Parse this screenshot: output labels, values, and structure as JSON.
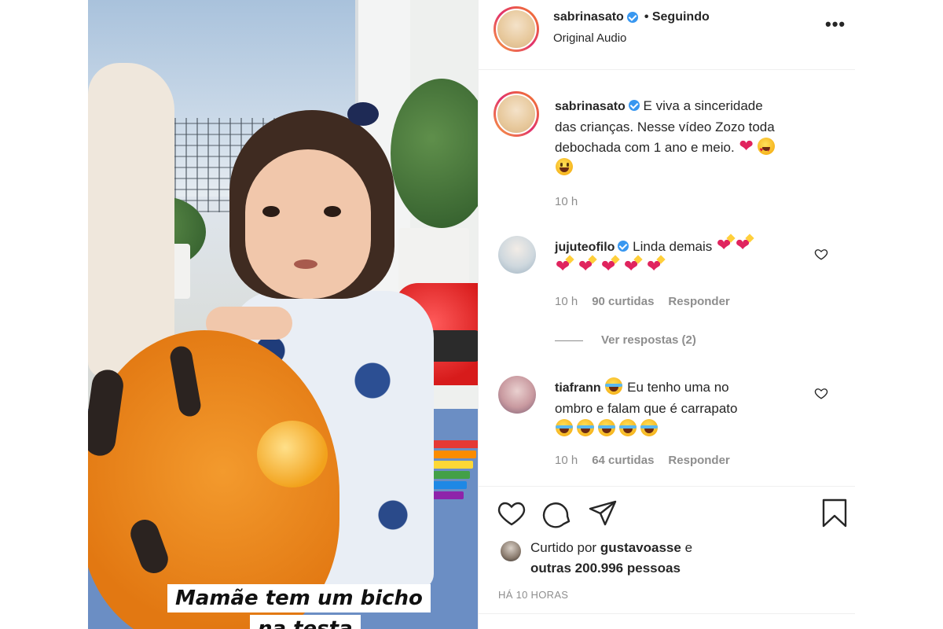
{
  "post": {
    "author": "sabrinasato",
    "follow_status": "• Seguindo",
    "audio": "Original Audio",
    "more_label": "•••"
  },
  "video": {
    "caption_line1": "Mamãe tem um bicho",
    "caption_line2": "na testa"
  },
  "caption": {
    "username": "sabrinasato",
    "line1": "E viva a sinceridade",
    "line2": "das crianças. Nesse vídeo Zozo toda",
    "line3": "debochada com 1 ano e meio.",
    "time": "10 h"
  },
  "comments": [
    {
      "username": "jujuteofilo",
      "verified": true,
      "text": "Linda demais",
      "time": "10 h",
      "likes": "90 curtidas",
      "reply": "Responder",
      "view_replies": "Ver respostas (2)"
    },
    {
      "username": "tiafrann",
      "verified": false,
      "text_line1": "Eu tenho uma no",
      "text_line2": "ombro e falam que é carrapato",
      "time": "10 h",
      "likes": "64 curtidas",
      "reply": "Responder"
    }
  ],
  "likes": {
    "prefix": "Curtido por",
    "user": "gustavoasse",
    "conjunction": "e",
    "others": "outras 200.996 pessoas"
  },
  "timestamp": "HÁ 10 HORAS",
  "colors": {
    "verified": "#3897f0",
    "text": "#262626",
    "muted": "#8e8e8e",
    "heart": "#e0245e"
  },
  "icons": [
    "heart-icon",
    "comment-icon",
    "share-icon",
    "bookmark-icon",
    "more-icon",
    "verified-icon"
  ]
}
